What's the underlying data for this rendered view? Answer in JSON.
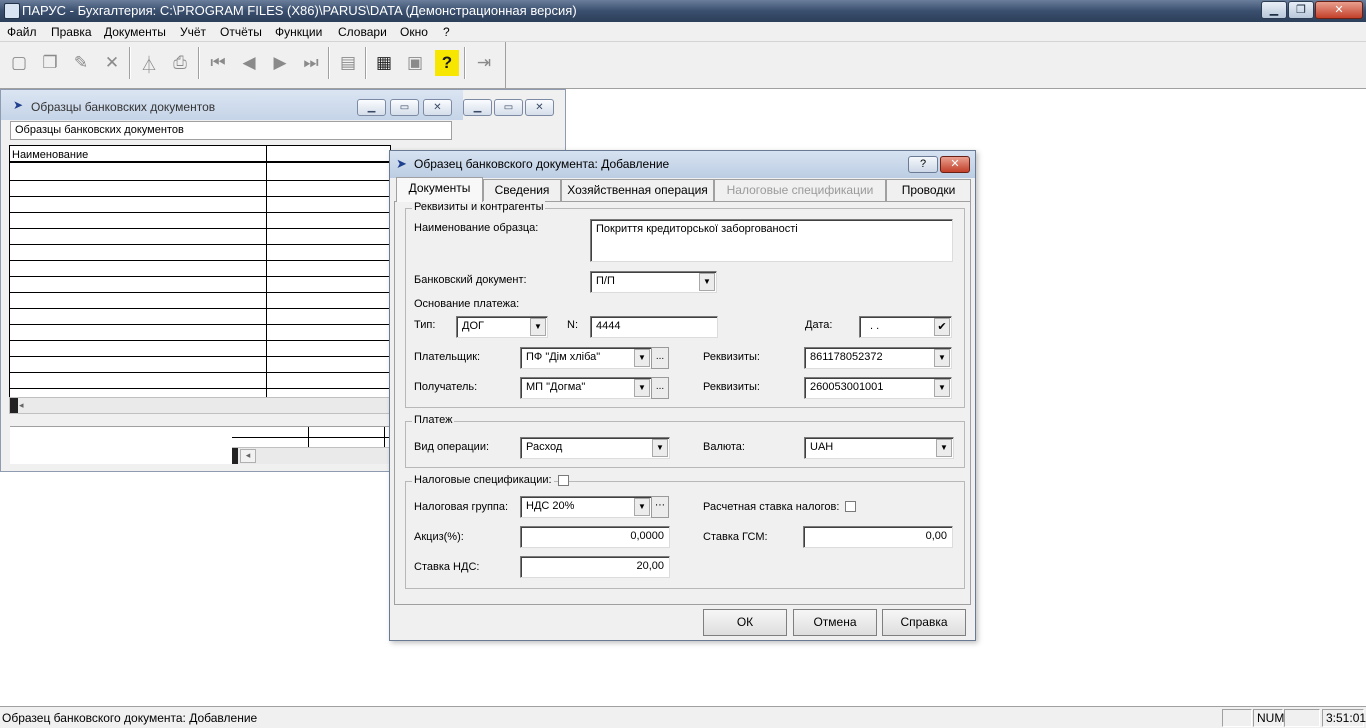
{
  "window": {
    "title": "ПАРУС - Бухгалтерия: C:\\PROGRAM FILES (X86)\\PARUS\\DATA (Демонстрационная версия)"
  },
  "menu": [
    "Файл",
    "Правка",
    "Документы",
    "Учёт",
    "Отчёты",
    "Функции",
    "Словари",
    "Окно",
    "?"
  ],
  "toolbar": {
    "buttons": [
      {
        "name": "new-icon",
        "glyph": "▢"
      },
      {
        "name": "copy-icon",
        "glyph": "❐"
      },
      {
        "name": "edit-icon",
        "glyph": "✎"
      },
      {
        "name": "delete-icon",
        "glyph": "✕"
      },
      {
        "name": "filter-icon",
        "glyph": "⏃"
      },
      {
        "name": "print-icon",
        "glyph": "⎙"
      },
      {
        "name": "first-icon",
        "glyph": "⏮"
      },
      {
        "name": "prev-icon",
        "glyph": "◀"
      },
      {
        "name": "next-icon",
        "glyph": "▶"
      },
      {
        "name": "last-icon",
        "glyph": "⏭"
      },
      {
        "name": "report-icon",
        "glyph": "▤"
      },
      {
        "name": "calculator-icon",
        "glyph": "▦"
      },
      {
        "name": "system-garant-icon",
        "glyph": "▣"
      },
      {
        "name": "help-icon",
        "glyph": "?"
      },
      {
        "name": "exit-icon",
        "glyph": "⇥"
      }
    ]
  },
  "bg_window": {
    "title": "Образцы банковских документов",
    "label": "Образцы банковских документов",
    "column_header": "Наименование"
  },
  "dialog": {
    "title": "Образец банковского документа: Добавление",
    "tabs": [
      "Документы",
      "Сведения",
      "Хозяйственная операция",
      "Налоговые спецификации",
      "Проводки"
    ],
    "group_requisites": "Реквизиты и контрагенты",
    "sample_name_label": "Наименование образца:",
    "sample_name_value": "Покриття кредиторської заборгованості",
    "bank_doc_label": "Банковский документ:",
    "bank_doc_value": "П/П",
    "payment_basis_label": "Основание платежа:",
    "type_label": "Тип:",
    "type_value": "ДОГ",
    "n_label": "N:",
    "n_value": "4444",
    "date_label": "Дата:",
    "date_value": ". .",
    "payer_label": "Плательщик:",
    "payer_value": "ПФ \"Дім хліба\"",
    "payer_req_label": "Реквизиты:",
    "payer_req_value": "861178052372",
    "recipient_label": "Получатель:",
    "recipient_value": "МП \"Догма\"",
    "recipient_req_label": "Реквизиты:",
    "recipient_req_value": "260053001001",
    "group_payment": "Платеж",
    "op_type_label": "Вид операции:",
    "op_type_value": "Расход",
    "currency_label": "Валюта:",
    "currency_value": "UAH",
    "group_tax": "Налоговые спецификации:",
    "tax_group_label": "Налоговая группа:",
    "tax_group_value": "НДС 20%",
    "calc_rate_label": "Расчетная ставка налогов:",
    "excise_label": "Акциз(%):",
    "excise_value": "0,0000",
    "gsm_rate_label": "Ставка ГСМ:",
    "gsm_rate_value": "0,00",
    "vat_rate_label": "Ставка НДС:",
    "vat_rate_value": "20,00",
    "ok": "ОК",
    "cancel": "Отмена",
    "help": "Справка"
  },
  "status": {
    "text": "Образец банковского документа: Добавление",
    "num": "NUM",
    "time": "3:51:01"
  }
}
